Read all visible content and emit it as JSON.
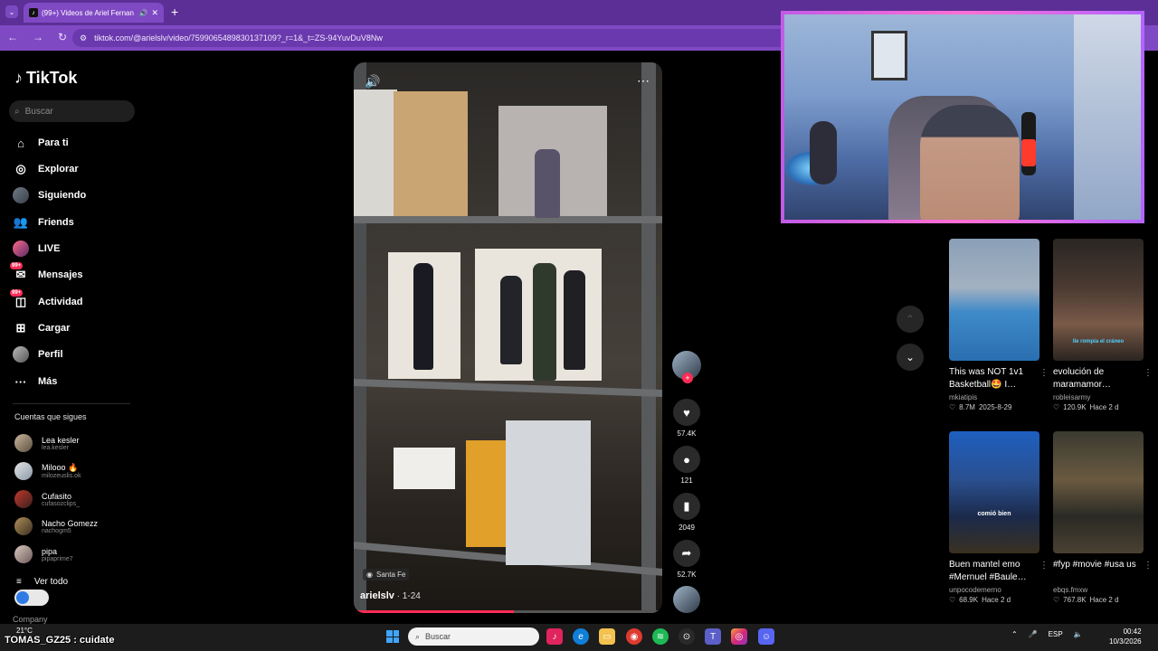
{
  "browser": {
    "tab_title": "(99+) Videos de Ariel Fernan…",
    "url": "tiktok.com/@arielslv/video/7599065489830137109?_r=1&_t=ZS-94YuvDuV8Nw"
  },
  "sidebar": {
    "logo": "TikTok",
    "search_placeholder": "Buscar",
    "items": [
      {
        "label": "Para ti",
        "icon": "home-icon"
      },
      {
        "label": "Explorar",
        "icon": "compass-icon"
      },
      {
        "label": "Siguiendo",
        "icon": "following-avatar-icon"
      },
      {
        "label": "Friends",
        "icon": "friends-icon"
      },
      {
        "label": "LIVE",
        "icon": "live-icon"
      },
      {
        "label": "Mensajes",
        "icon": "message-icon",
        "badge": "99+"
      },
      {
        "label": "Actividad",
        "icon": "activity-icon",
        "badge": "99+"
      },
      {
        "label": "Cargar",
        "icon": "upload-icon"
      },
      {
        "label": "Perfil",
        "icon": "profile-icon"
      },
      {
        "label": "Más",
        "icon": "more-icon"
      }
    ],
    "following_header": "Cuentas que sigues",
    "following": [
      {
        "name": "Lea kesler",
        "handle": "lea.kesler"
      },
      {
        "name": "Milooo 🔥",
        "handle": "milozeuslis.ok"
      },
      {
        "name": "Cufasito",
        "handle": "cufasozclips_"
      },
      {
        "name": "Nacho Gomezz",
        "handle": "nachogm5"
      },
      {
        "name": "pipa",
        "handle": "pipaprime7"
      }
    ],
    "see_all": "Ver todo",
    "company": "Company"
  },
  "video": {
    "location": "Santa Fe",
    "author": "arielslv",
    "date": " · 1-24",
    "progress": 0.52
  },
  "actions": {
    "likes": "57.4K",
    "comments": "121",
    "saves": "2049",
    "shares": "52.7K"
  },
  "recommended": [
    {
      "title": "This was NOT 1v1 Basketball🤩 I…",
      "user": "mkiatipis",
      "views": "8.7M",
      "date": "2025-8-29",
      "caption": ""
    },
    {
      "title": "evolución de maramamor…",
      "user": "robleisarmy",
      "views": "120.9K",
      "date": "Hace 2 d",
      "caption": "Ile rompía el cráneo"
    },
    {
      "title": "Buen mantel emo #Mernuel #Baule…",
      "user": "unpocodemerno",
      "views": "68.9K",
      "date": "Hace 2 d",
      "caption": "comió bien"
    },
    {
      "title": "#fyp #movie #usa us",
      "user": "ebqs.fmxw",
      "views": "767.8K",
      "date": "Hace 2 d",
      "caption": ""
    }
  ],
  "stream": {
    "caption": "TOMAS_GZ25 : cuidate",
    "weather": "21°C"
  },
  "taskbar": {
    "search": "Buscar",
    "lang": "ESP",
    "time": "00:42",
    "date": "10/3/2026"
  }
}
